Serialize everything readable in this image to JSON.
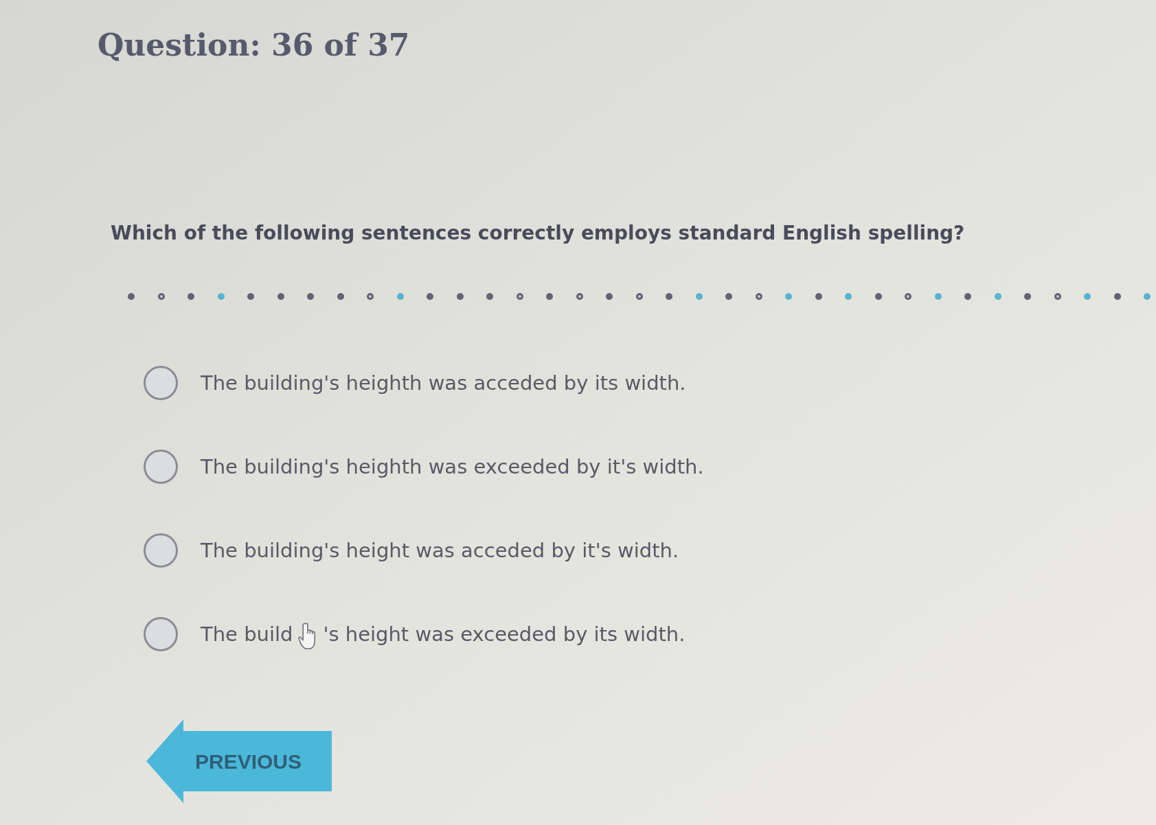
{
  "header": {
    "title": "Question: 36 of 37"
  },
  "question": {
    "prompt": "Which of the following sentences correctly employs standard English spelling?"
  },
  "progress_dots": [
    {
      "kind": "dot",
      "color": "#626373"
    },
    {
      "kind": "ring",
      "color": "#626373"
    },
    {
      "kind": "dot",
      "color": "#626373"
    },
    {
      "kind": "dot",
      "color": "#5ab4cf"
    },
    {
      "kind": "dot",
      "color": "#626373"
    },
    {
      "kind": "dot",
      "color": "#626373"
    },
    {
      "kind": "dot",
      "color": "#626373"
    },
    {
      "kind": "dot",
      "color": "#626373"
    },
    {
      "kind": "ring",
      "color": "#626373"
    },
    {
      "kind": "dot",
      "color": "#5ab4cf"
    },
    {
      "kind": "dot",
      "color": "#626373"
    },
    {
      "kind": "dot",
      "color": "#626373"
    },
    {
      "kind": "dot",
      "color": "#626373"
    },
    {
      "kind": "ring",
      "color": "#626373"
    },
    {
      "kind": "dot",
      "color": "#626373"
    },
    {
      "kind": "ring",
      "color": "#626373"
    },
    {
      "kind": "dot",
      "color": "#626373"
    },
    {
      "kind": "ring",
      "color": "#626373"
    },
    {
      "kind": "dot",
      "color": "#626373"
    },
    {
      "kind": "dot",
      "color": "#5ab4cf"
    },
    {
      "kind": "dot",
      "color": "#626373"
    },
    {
      "kind": "ring",
      "color": "#626373"
    },
    {
      "kind": "dot",
      "color": "#5ab4cf"
    },
    {
      "kind": "dot",
      "color": "#626373"
    },
    {
      "kind": "dot",
      "color": "#5ab4cf"
    },
    {
      "kind": "dot",
      "color": "#626373"
    },
    {
      "kind": "ring",
      "color": "#626373"
    },
    {
      "kind": "dot",
      "color": "#5ab4cf"
    },
    {
      "kind": "dot",
      "color": "#626373"
    },
    {
      "kind": "dot",
      "color": "#5ab4cf"
    },
    {
      "kind": "dot",
      "color": "#626373"
    },
    {
      "kind": "ring",
      "color": "#626373"
    },
    {
      "kind": "dot",
      "color": "#5ab4cf"
    },
    {
      "kind": "dot",
      "color": "#626373"
    },
    {
      "kind": "dot",
      "color": "#5ab4cf"
    }
  ],
  "options": [
    {
      "label": "The building's heighth was acceded by its width.",
      "selected": false
    },
    {
      "label": "The building's heighth was exceeded by it's width.",
      "selected": false
    },
    {
      "label": "The building's height was acceded by it's width.",
      "selected": false
    },
    {
      "label": "The build",
      "label_after": "'s height was exceeded by its width.",
      "selected": false
    }
  ],
  "buttons": [
    {
      "kind": "previous",
      "label": "PREVIOUS"
    }
  ]
}
